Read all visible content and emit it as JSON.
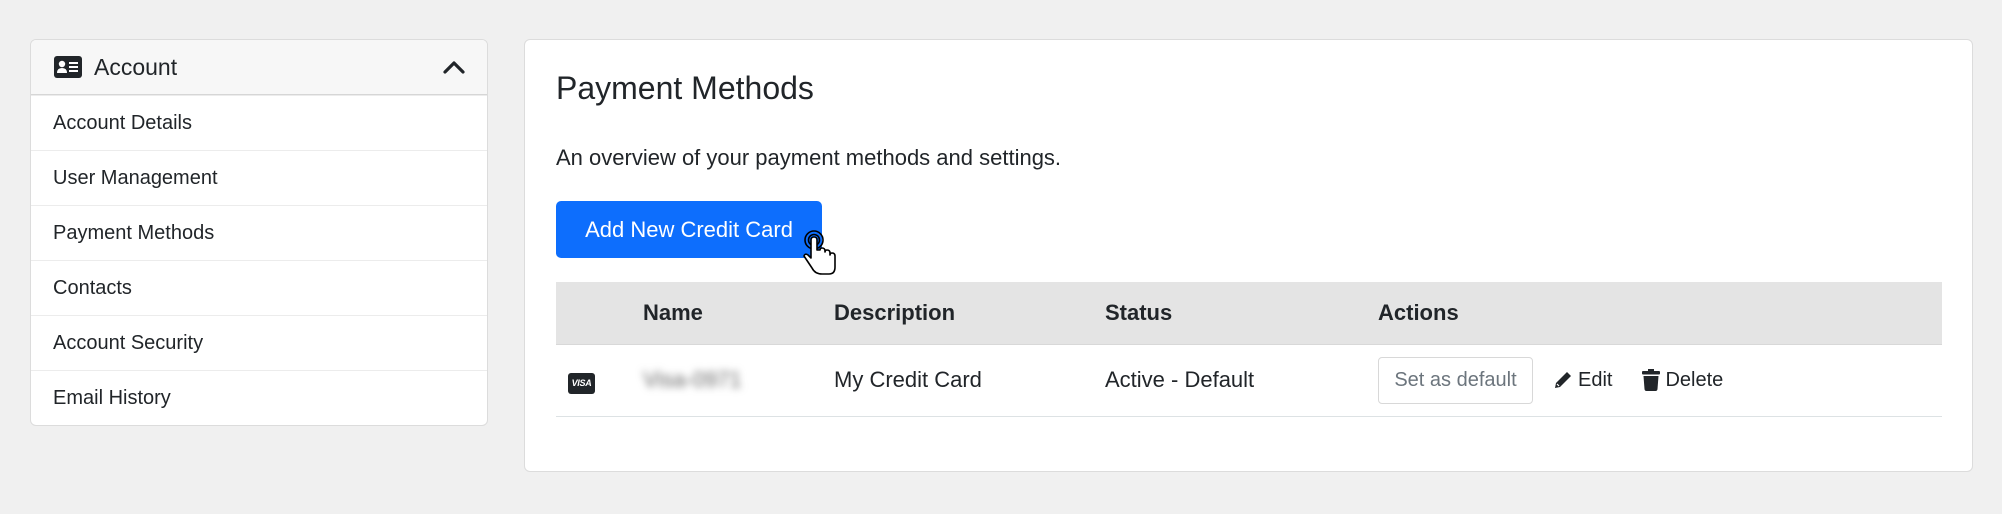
{
  "sidebar": {
    "header": {
      "title": "Account",
      "icon": "id-card-icon",
      "toggle_icon": "chevron-up-icon"
    },
    "items": [
      {
        "label": "Account Details"
      },
      {
        "label": "User Management"
      },
      {
        "label": "Payment Methods"
      },
      {
        "label": "Contacts"
      },
      {
        "label": "Account Security"
      },
      {
        "label": "Email History"
      }
    ]
  },
  "main": {
    "title": "Payment Methods",
    "subtitle": "An overview of your payment methods and settings.",
    "add_button_label": "Add New Credit Card",
    "table": {
      "columns": [
        "",
        "Name",
        "Description",
        "Status",
        "Actions"
      ],
      "rows": [
        {
          "card_brand": "VISA",
          "name": "Visa-0971",
          "name_blurred": true,
          "description": "My Credit Card",
          "status": "Active - Default",
          "actions": {
            "set_default_label": "Set as default",
            "edit_label": "Edit",
            "delete_label": "Delete"
          }
        }
      ]
    }
  },
  "colors": {
    "primary": "#0d6efd",
    "page_bg": "#f0f0f0",
    "table_header_bg": "#e4e4e4"
  }
}
